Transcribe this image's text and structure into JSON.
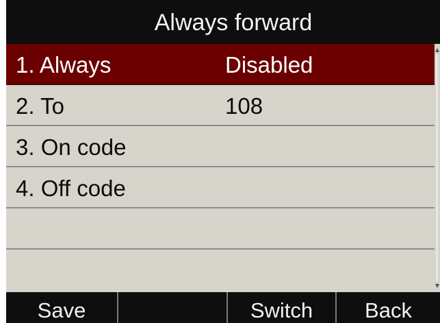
{
  "title": "Always forward",
  "menu": {
    "items": [
      {
        "label": "1. Always",
        "value": "Disabled"
      },
      {
        "label": "2. To",
        "value": "108"
      },
      {
        "label": "3. On code",
        "value": ""
      },
      {
        "label": "4. Off code",
        "value": ""
      },
      {
        "label": "",
        "value": ""
      },
      {
        "label": "",
        "value": ""
      }
    ],
    "selected_index": 0
  },
  "softkeys": {
    "key1": "Save",
    "key2": "",
    "key3": "Switch",
    "key4": "Back"
  },
  "colors": {
    "title_bg": "#0e0e0e",
    "selected_row": "#6b0000",
    "row_bg": "#d6d4cb",
    "softkey_bg": "#0e0e0e"
  }
}
